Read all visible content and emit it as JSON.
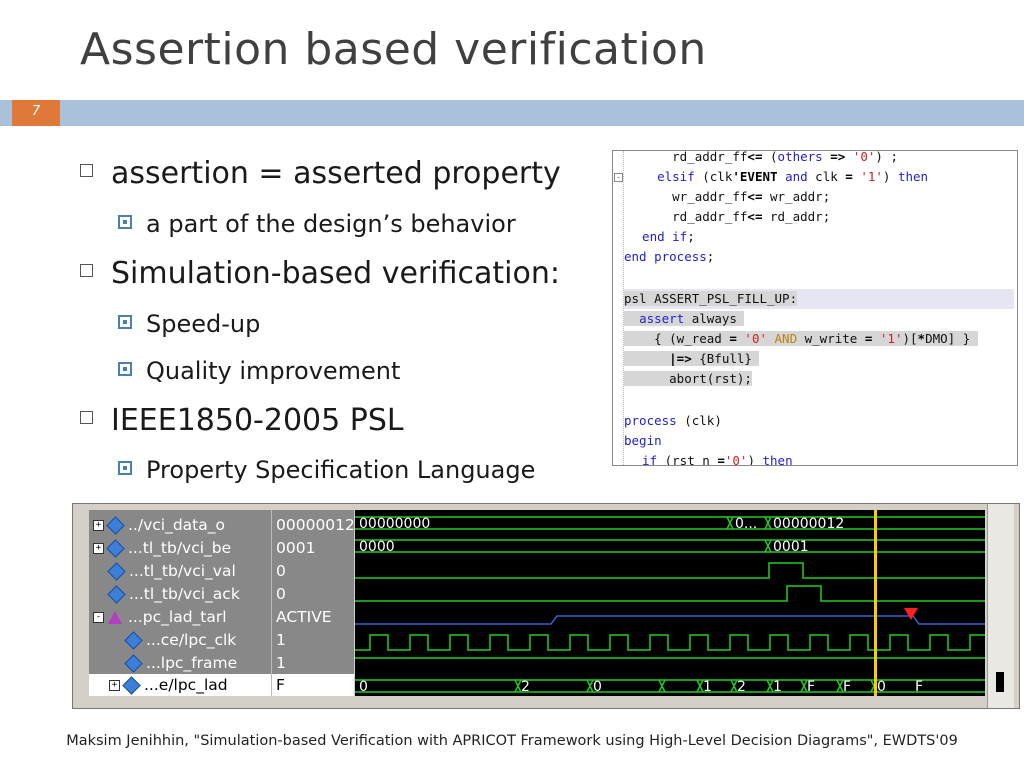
{
  "slide": {
    "title": "Assertion based verification",
    "number": "7",
    "footer": "Maksim Jenihhin, \"Simulation-based Verification with APRICOT Framework using High-Level Decision Diagrams\", EWDTS'09"
  },
  "bullets": [
    {
      "level": 1,
      "text": "assertion = asserted property"
    },
    {
      "level": 2,
      "text": "a part of the design’s behavior"
    },
    {
      "level": 1,
      "text": "Simulation-based verification:"
    },
    {
      "level": 2,
      "text": "Speed-up"
    },
    {
      "level": 2,
      "text": "Quality improvement"
    },
    {
      "level": 1,
      "text": "IEEE1850-2005 PSL"
    },
    {
      "level": 2,
      "text": "Property Specification Language"
    }
  ],
  "code": {
    "lines": [
      "      rd_addr_ff<= (others => '0') ;",
      "    elsif (clk'EVENT and clk = '1') then",
      "      wr_addr_ff<= wr_addr;",
      "      rd_addr_ff<= rd_addr;",
      "  end if;",
      "end process;",
      "",
      "psl ASSERT_PSL_FILL_UP:",
      "  assert always",
      "    { (w_read = '0' AND w_write = '1')[*DMO] }",
      "      |=> {Bfull}",
      "      abort(rst);",
      "",
      "process (clk)",
      "begin",
      "  if (rst_n ='0') then"
    ]
  },
  "waveform": {
    "signals": [
      {
        "name": "../vci_data_o",
        "value": "00000012",
        "icon": "diamond",
        "expand": "+"
      },
      {
        "name": "...tl_tb/vci_be",
        "value": "0001",
        "icon": "diamond",
        "expand": "+"
      },
      {
        "name": "...tl_tb/vci_val",
        "value": "0",
        "icon": "diamond",
        "expand": ""
      },
      {
        "name": "...tl_tb/vci_ack",
        "value": "0",
        "icon": "diamond",
        "expand": ""
      },
      {
        "name": "...pc_lad_tarl",
        "value": "ACTIVE",
        "icon": "triangle",
        "expand": "-"
      },
      {
        "name": "...ce/lpc_clk",
        "value": "1",
        "icon": "diamond",
        "expand": ""
      },
      {
        "name": "...lpc_frame",
        "value": "1",
        "icon": "diamond",
        "expand": ""
      },
      {
        "name": "...e/lpc_lad",
        "value": "F",
        "icon": "diamond",
        "expand": "+",
        "selected": true
      }
    ],
    "bus_labels": {
      "vci_data_o": [
        "00000000",
        "0...",
        "00000012"
      ],
      "vci_be": [
        "0000",
        "0001"
      ],
      "lpc_lad": [
        "0",
        "2",
        "0",
        "1",
        "2",
        "1",
        "F",
        "F",
        "0",
        "F"
      ]
    },
    "colors": {
      "wave": "#22cc22",
      "cursor": "#ffcc00",
      "marker": "#ff2020",
      "state": "#3a5fd0"
    }
  }
}
